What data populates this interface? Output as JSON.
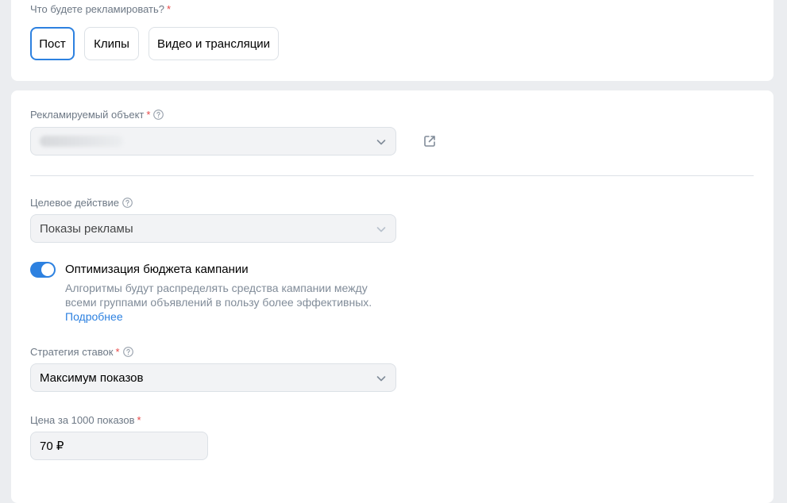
{
  "ad_type": {
    "label": "Что будете рекламировать?",
    "required_mark": "*",
    "options": [
      {
        "label": "Пост",
        "active": true
      },
      {
        "label": "Клипы",
        "active": false
      },
      {
        "label": "Видео и трансляции",
        "active": false
      }
    ]
  },
  "ad_object": {
    "label": "Рекламируемый объект",
    "required_mark": "*",
    "value_hidden": true,
    "icons": [
      "help-icon",
      "chevron-down-icon",
      "external-link-icon"
    ]
  },
  "target_action": {
    "label": "Целевое действие",
    "value": "Показы рекламы",
    "disabled": true
  },
  "budget_optimization": {
    "title": "Оптимизация бюджета кампании",
    "enabled": true,
    "description": "Алгоритмы будут распределять средства кампании между всеми группами объявлений в пользу более эффективных.",
    "link_label": "Подробнее"
  },
  "bid_strategy": {
    "label": "Стратегия ставок",
    "required_mark": "*",
    "value": "Максимум показов"
  },
  "price": {
    "label": "Цена за 1000 показов",
    "required_mark": "*",
    "value": "70 ₽"
  },
  "colors": {
    "accent": "#2d81e0",
    "required": "#e64646",
    "background": "#ebedf0"
  }
}
